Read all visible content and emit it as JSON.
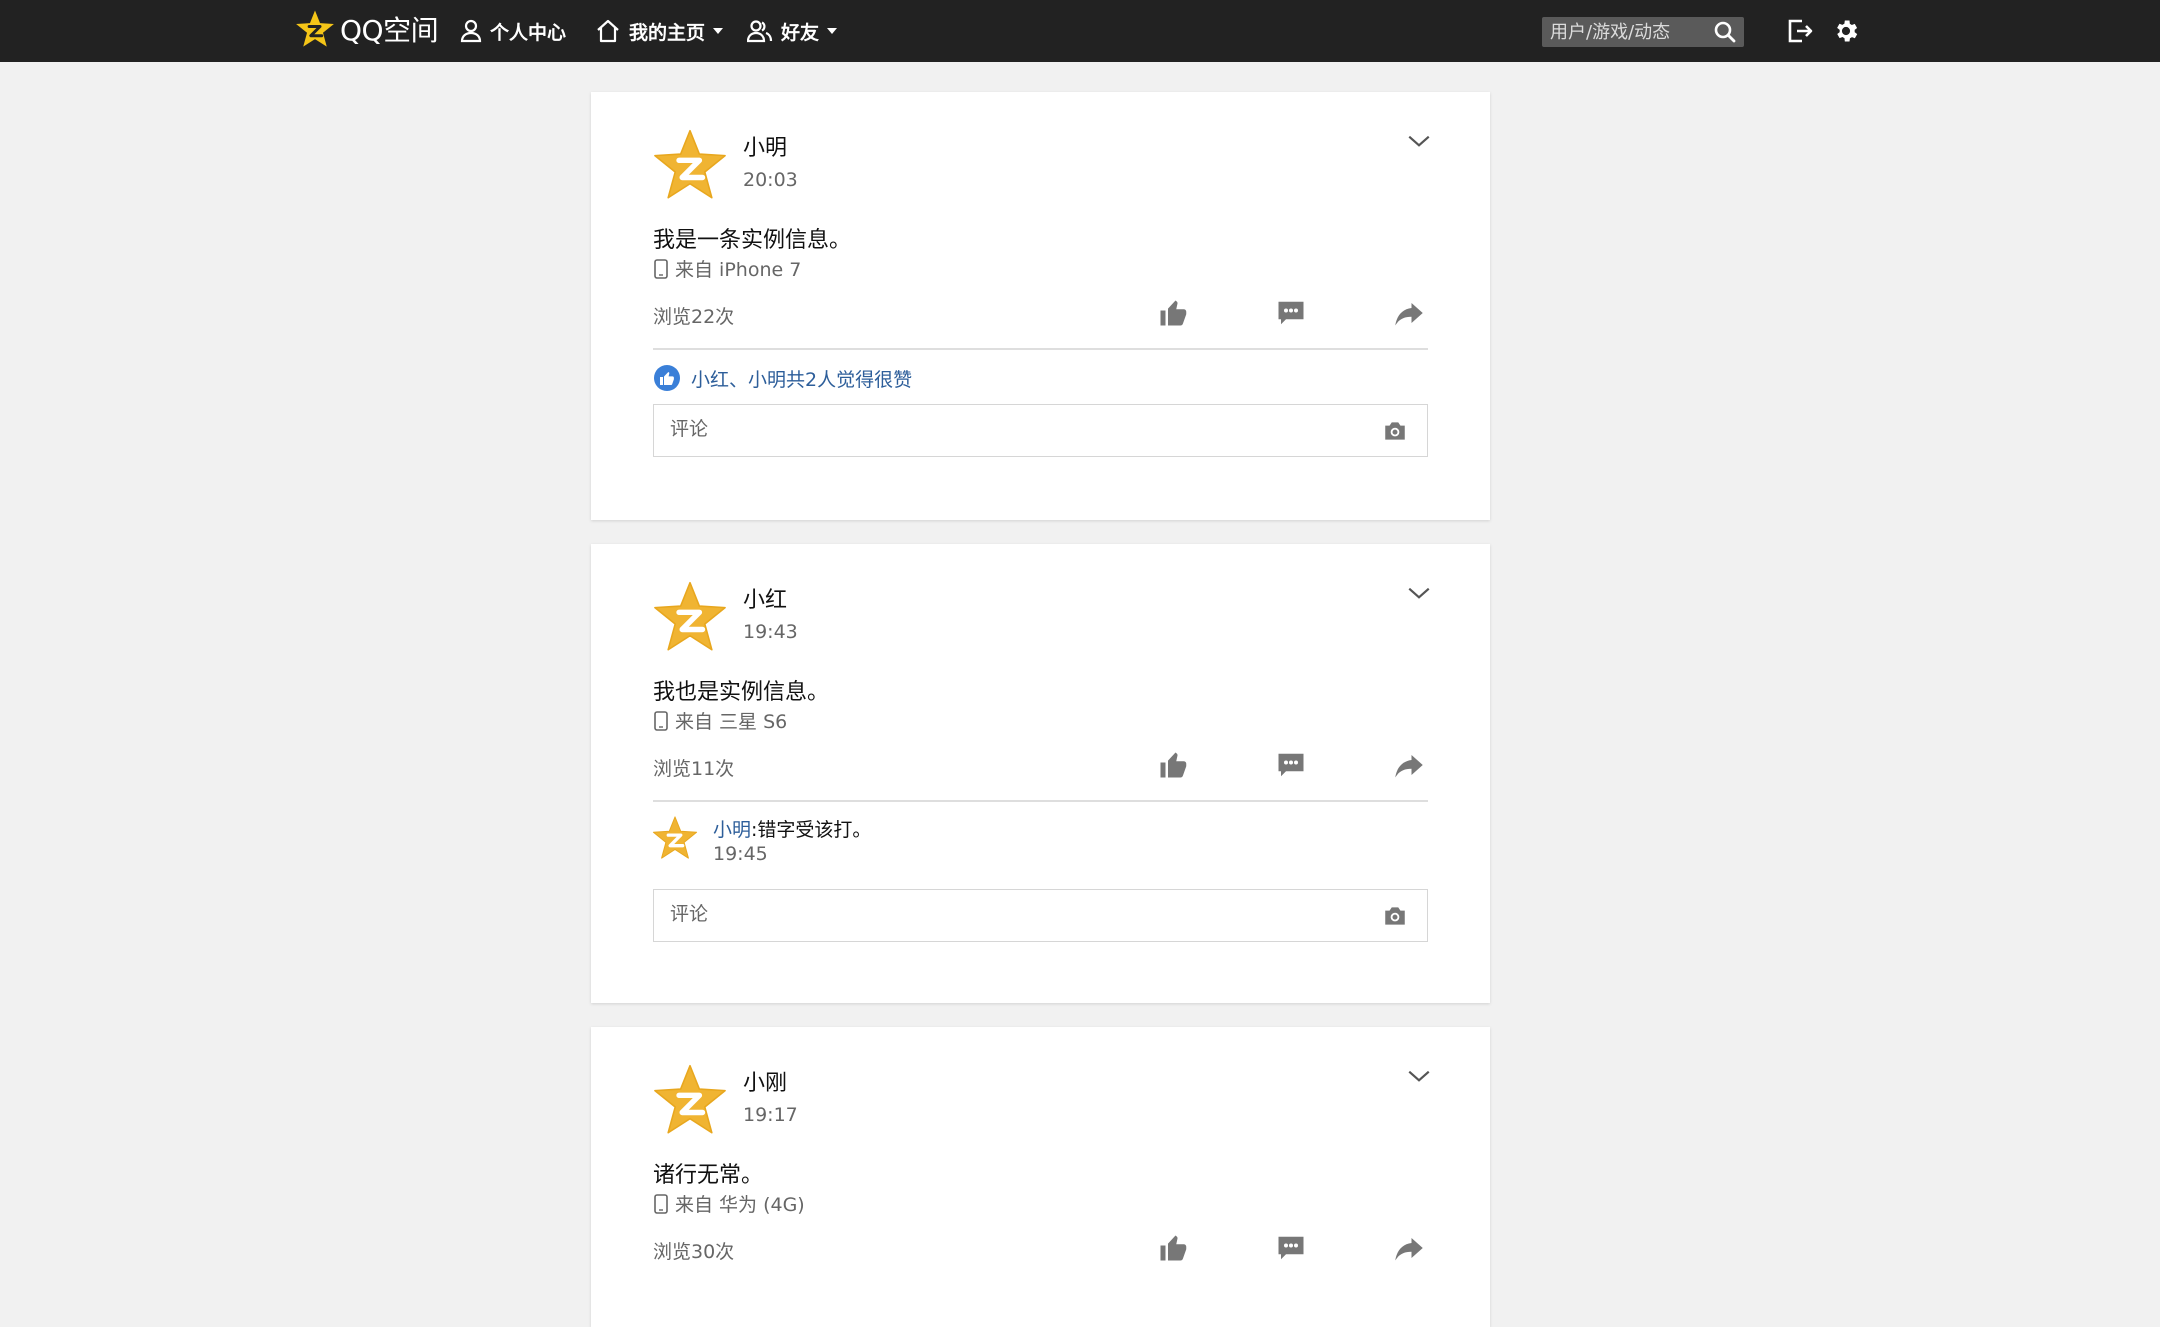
{
  "app": {
    "logo_text": "QQ空间",
    "nav": [
      {
        "label": "个人中心",
        "icon": "user-icon"
      },
      {
        "label": "我的主页",
        "icon": "home-icon",
        "dropdown": true
      },
      {
        "label": "好友",
        "icon": "friends-icon",
        "dropdown": true
      }
    ],
    "search_placeholder": "用户/游戏/动态",
    "brand_color": "#f5c518",
    "link_color": "#2d5e9a"
  },
  "posts": [
    {
      "author": "小明",
      "time": "20:03",
      "content": "我是一条实例信息。",
      "device": "来自 iPhone 7",
      "views": "浏览22次",
      "likes": "小红、小明共2人觉得很赞",
      "comment_placeholder": "评论"
    },
    {
      "author": "小红",
      "time": "19:43",
      "content": "我也是实例信息。",
      "device": "来自 三星 S6",
      "views": "浏览11次",
      "reply": {
        "name": "小明",
        "text": ":错字受该打。",
        "time": "19:45"
      },
      "comment_placeholder": "评论"
    },
    {
      "author": "小刚",
      "time": "19:17",
      "content": "诸行无常。",
      "device": "来自 华为 (4G)",
      "views": "浏览30次"
    }
  ]
}
